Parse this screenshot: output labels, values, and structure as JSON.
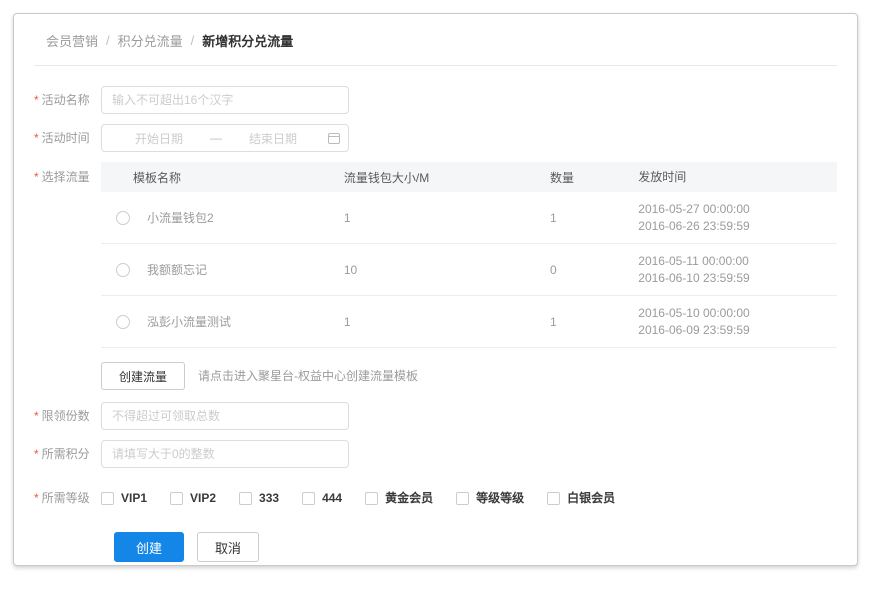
{
  "breadcrumb": {
    "items": [
      "会员营销",
      "积分兑流量"
    ],
    "current": "新增积分兑流量",
    "separator": "/"
  },
  "form": {
    "required_marker": "*",
    "activity_name": {
      "label": "活动名称",
      "placeholder": "输入不可超出16个汉字",
      "value": ""
    },
    "activity_time": {
      "label": "活动时间",
      "start_placeholder": "开始日期",
      "dash": "—",
      "end_placeholder": "结束日期"
    },
    "select_traffic": {
      "label": "选择流量"
    },
    "create_traffic": {
      "button_label": "创建流量",
      "hint": "请点击进入聚星台-权益中心创建流量模板"
    },
    "quota": {
      "label": "限领份数",
      "placeholder": "不得超过可领取总数",
      "value": ""
    },
    "points": {
      "label": "所需积分",
      "placeholder": "请填写大于0的整数",
      "value": ""
    },
    "levels": {
      "label": "所需等级",
      "options": [
        "VIP1",
        "VIP2",
        "333",
        "444",
        "黄金会员",
        "等级等级",
        "白银会员"
      ]
    },
    "submit_label": "创建",
    "cancel_label": "取消"
  },
  "traffic_table": {
    "columns": [
      "模板名称",
      "流量钱包大小/M",
      "数量",
      "发放时间"
    ],
    "rows": [
      {
        "name": "小流量钱包2",
        "size": "1",
        "quantity": "1",
        "time_start": "2016-05-27 00:00:00",
        "time_end": "2016-06-26 23:59:59",
        "selected": false
      },
      {
        "name": "我额额忘记",
        "size": "10",
        "quantity": "0",
        "time_start": "2016-05-11 00:00:00",
        "time_end": "2016-06-10 23:59:59",
        "selected": false
      },
      {
        "name": "泓彭小流量测试",
        "size": "1",
        "quantity": "1",
        "time_start": "2016-05-10 00:00:00",
        "time_end": "2016-06-09 23:59:59",
        "selected": false
      }
    ]
  },
  "colors": {
    "primary_button": "#1486e8",
    "required_marker": "#f0583f",
    "table_header_bg": "#f5f6f8",
    "label_gray": "#9b9b9b"
  }
}
